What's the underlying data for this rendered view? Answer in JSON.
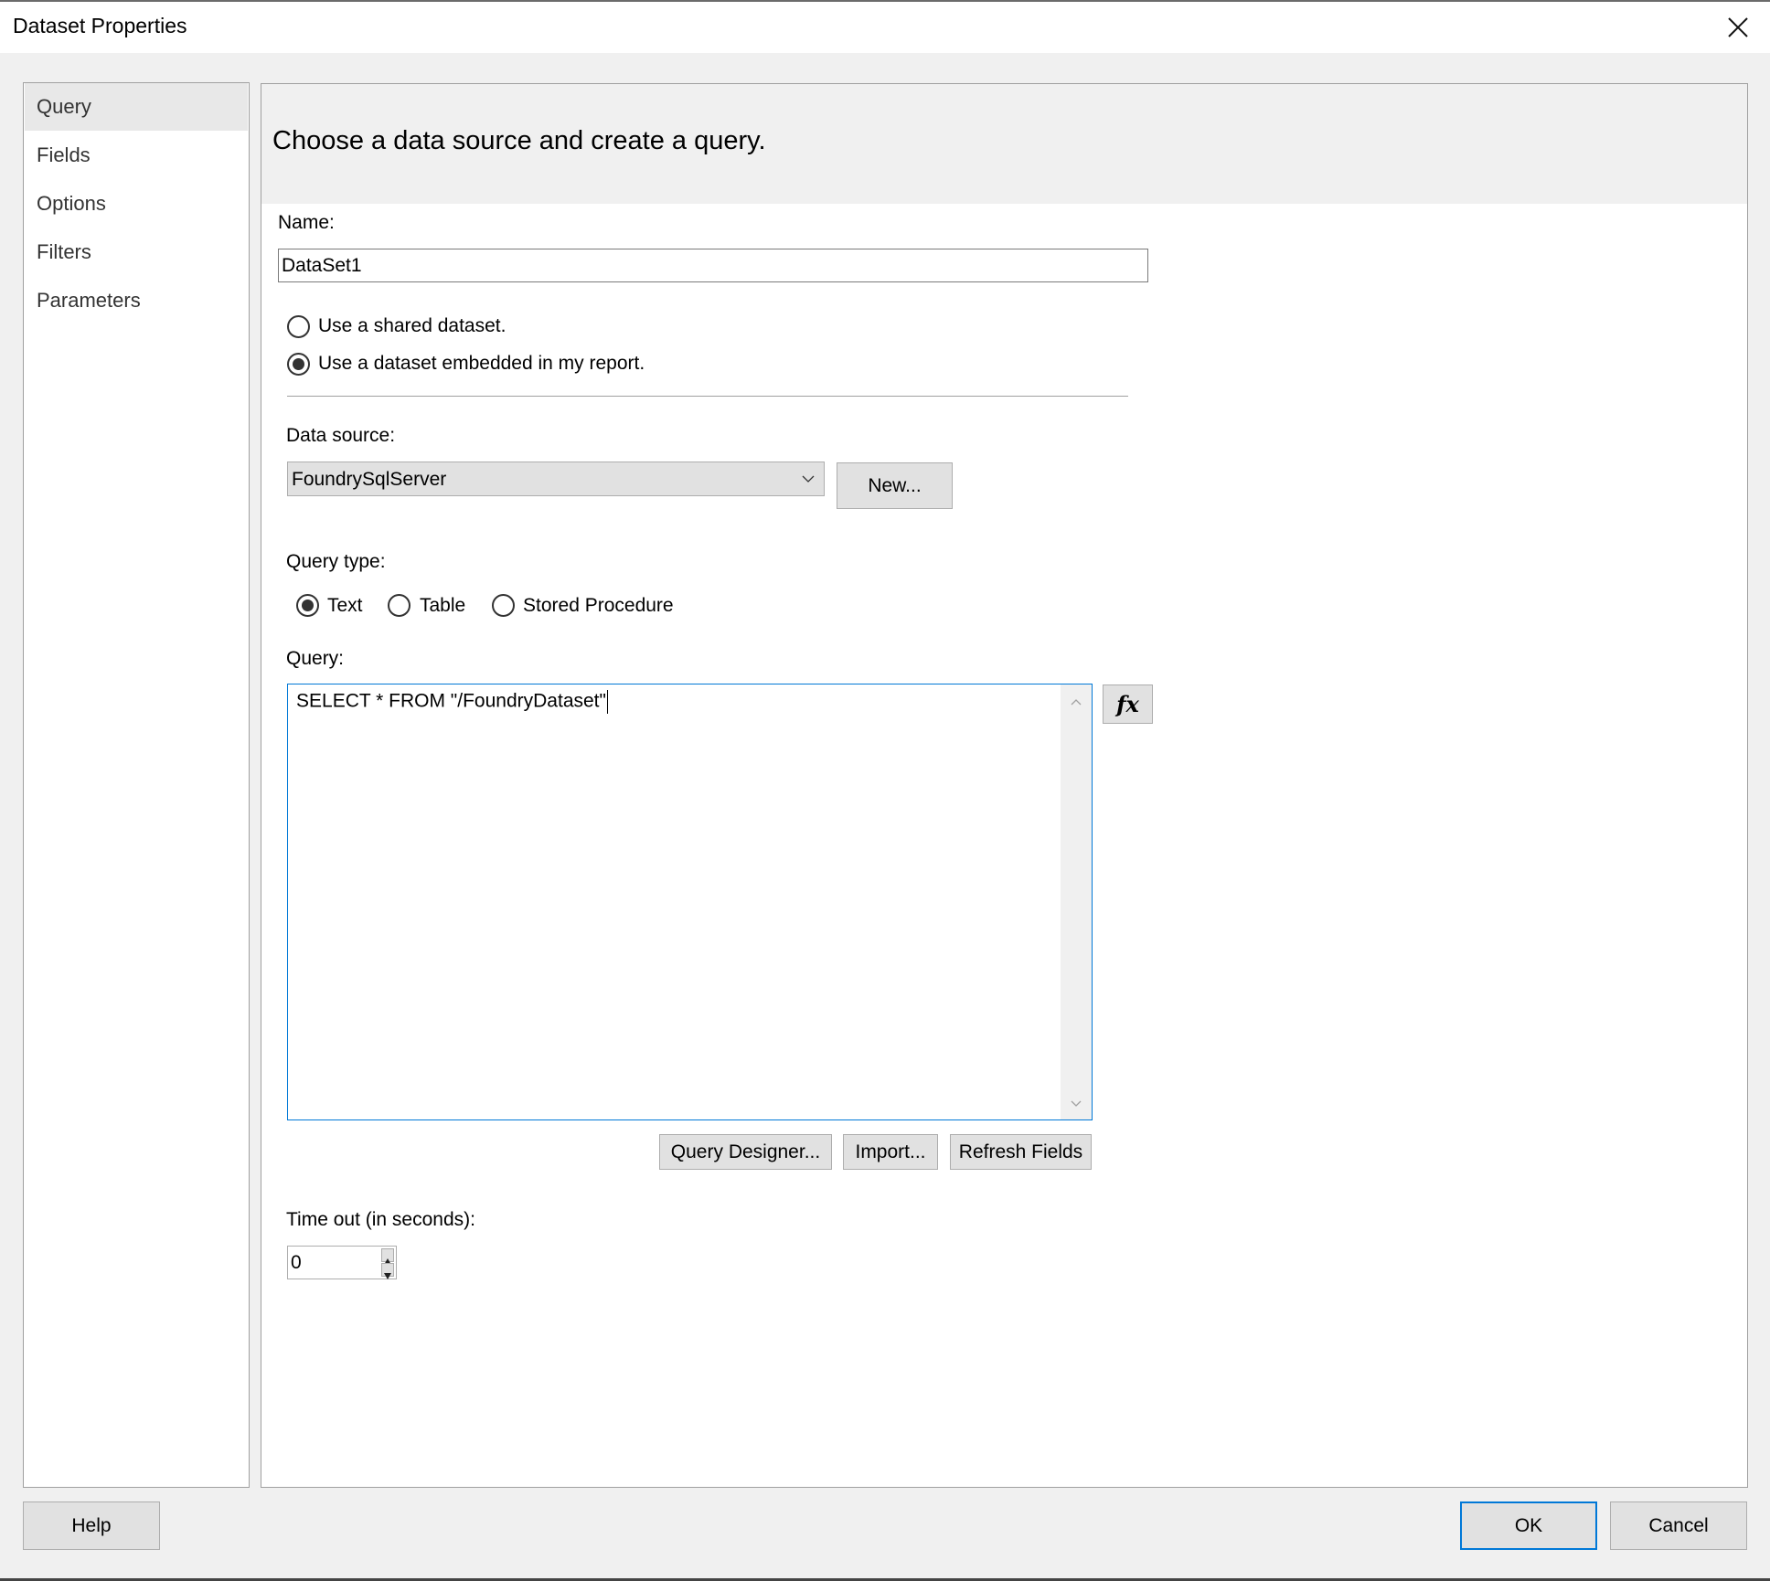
{
  "window": {
    "title": "Dataset Properties",
    "close_icon": "close-icon"
  },
  "sidebar": {
    "items": [
      {
        "label": "Query",
        "active": true
      },
      {
        "label": "Fields",
        "active": false
      },
      {
        "label": "Options",
        "active": false
      },
      {
        "label": "Filters",
        "active": false
      },
      {
        "label": "Parameters",
        "active": false
      }
    ]
  },
  "main": {
    "heading": "Choose a data source and create a query.",
    "name_label": "Name:",
    "name_value": "DataSet1",
    "dataset_options": [
      {
        "label": "Use a shared dataset.",
        "checked": false
      },
      {
        "label": "Use a dataset embedded in my report.",
        "checked": true
      }
    ],
    "data_source_label": "Data source:",
    "data_source_value": "FoundrySqlServer",
    "new_button": "New...",
    "query_type_label": "Query type:",
    "query_types": [
      {
        "label": "Text",
        "checked": true
      },
      {
        "label": "Table",
        "checked": false
      },
      {
        "label": "Stored Procedure",
        "checked": false
      }
    ],
    "query_label": "Query:",
    "query_value": "SELECT * FROM \"/FoundryDataset\"",
    "expression_button_glyph": "fx",
    "query_designer_button": "Query Designer...",
    "import_button": "Import...",
    "refresh_fields_button": "Refresh Fields",
    "timeout_label": "Time out (in seconds):",
    "timeout_value": "0"
  },
  "footer": {
    "help_button": "Help",
    "ok_button": "OK",
    "cancel_button": "Cancel"
  },
  "colors": {
    "accent": "#0078d7",
    "button_bg": "#e1e1e1",
    "dialog_bg": "#f0f0f0"
  }
}
